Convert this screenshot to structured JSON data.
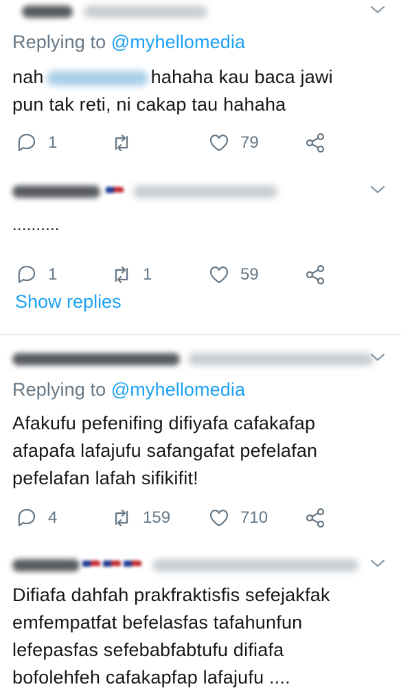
{
  "reply_to_prefix": "Replying to",
  "tweets": [
    {
      "reply_handle": "@myhellomedia",
      "body_a": "nah",
      "body_b": "hahaha kau baca jawi",
      "body_c": "pun tak reti, ni cakap tau hahaha",
      "replies": "1",
      "retweets": "",
      "likes": "79"
    },
    {
      "body": "..........",
      "replies": "1",
      "retweets": "1",
      "likes": "59"
    },
    {
      "reply_handle": "@myhellomedia",
      "lines": [
        "Afakufu pefenifing difiyafa cafakafap",
        "afapafa lafajufu safangafat pefelafan",
        "pefelafan lafah sifikifit!"
      ],
      "replies": "4",
      "retweets": "159",
      "likes": "710"
    },
    {
      "lines": [
        "Difiafa dahfah prakfraktisfis sefejakfak",
        "emfempatfat befelasfas tafahunfun",
        "lefepasfas sefebabfabtufu difiafa",
        "bofolehfeh cafakapfap lafajufu ...."
      ]
    }
  ],
  "show_replies": "Show replies",
  "colors": {
    "accent": "#1da1f2",
    "muted": "#657786",
    "text": "#14171a"
  }
}
